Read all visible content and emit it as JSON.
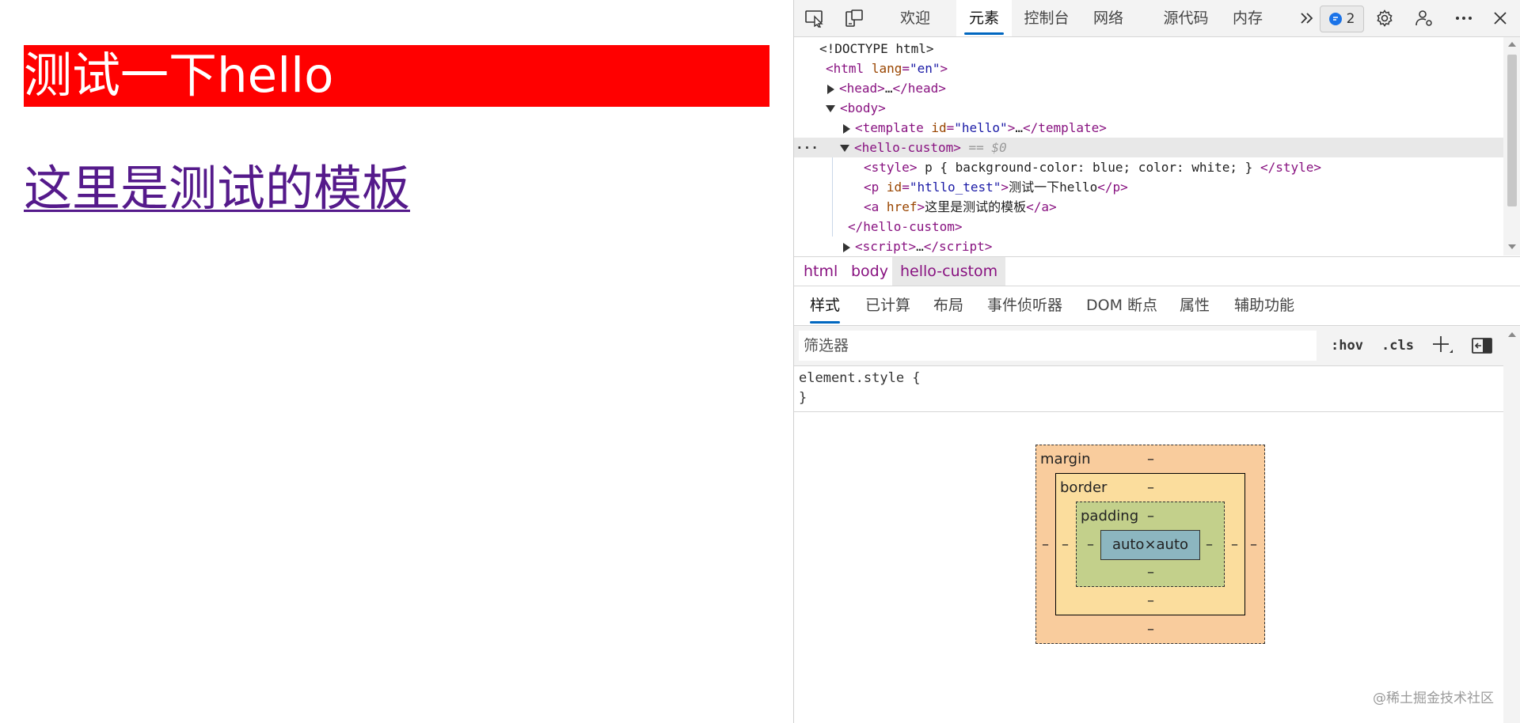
{
  "page": {
    "heading_text": "测试一下hello",
    "link_text": "这里是测试的模板"
  },
  "devtools": {
    "tabs": [
      "欢迎",
      "元素",
      "控制台",
      "网络",
      "源代码",
      "内存"
    ],
    "active_tab": "元素",
    "issues_count": "2",
    "dom": {
      "doctype": "<!DOCTYPE html>",
      "html_tag": "html",
      "html_attr": "lang",
      "html_attr_val": "\"en\"",
      "head": "head",
      "ellipsis": "…",
      "body": "body",
      "template_tag": "template",
      "template_attr": "id",
      "template_attr_val": "\"hello\"",
      "hello_custom": "hello-custom",
      "selected_marker": "== $0",
      "row_dots": "···",
      "style_tag": "style",
      "style_content": " p { background-color: blue; color: white; } ",
      "p_tag": "p",
      "p_attr": "id",
      "p_attr_val": "\"htllo_test\"",
      "p_text": "测试一下hello",
      "a_tag": "a",
      "a_attr": "href",
      "a_text": "这里是测试的模板",
      "script_tag": "script"
    },
    "breadcrumbs": [
      "html",
      "body",
      "hello-custom"
    ],
    "subtabs": [
      "样式",
      "已计算",
      "布局",
      "事件侦听器",
      "DOM 断点",
      "属性",
      "辅助功能"
    ],
    "filter_placeholder": "筛选器",
    "hov_label": ":hov",
    "cls_label": ".cls",
    "rule_selector": "element.style {",
    "rule_close": "}",
    "box_model": {
      "margin_label": "margin",
      "border_label": "border",
      "padding_label": "padding",
      "content": "auto×auto",
      "dash": "–"
    }
  },
  "watermark": "@稀土掘金技术社区",
  "colors": {
    "heading_bg": "#ff0000",
    "link": "#551a8b",
    "accent": "#0067c0"
  }
}
